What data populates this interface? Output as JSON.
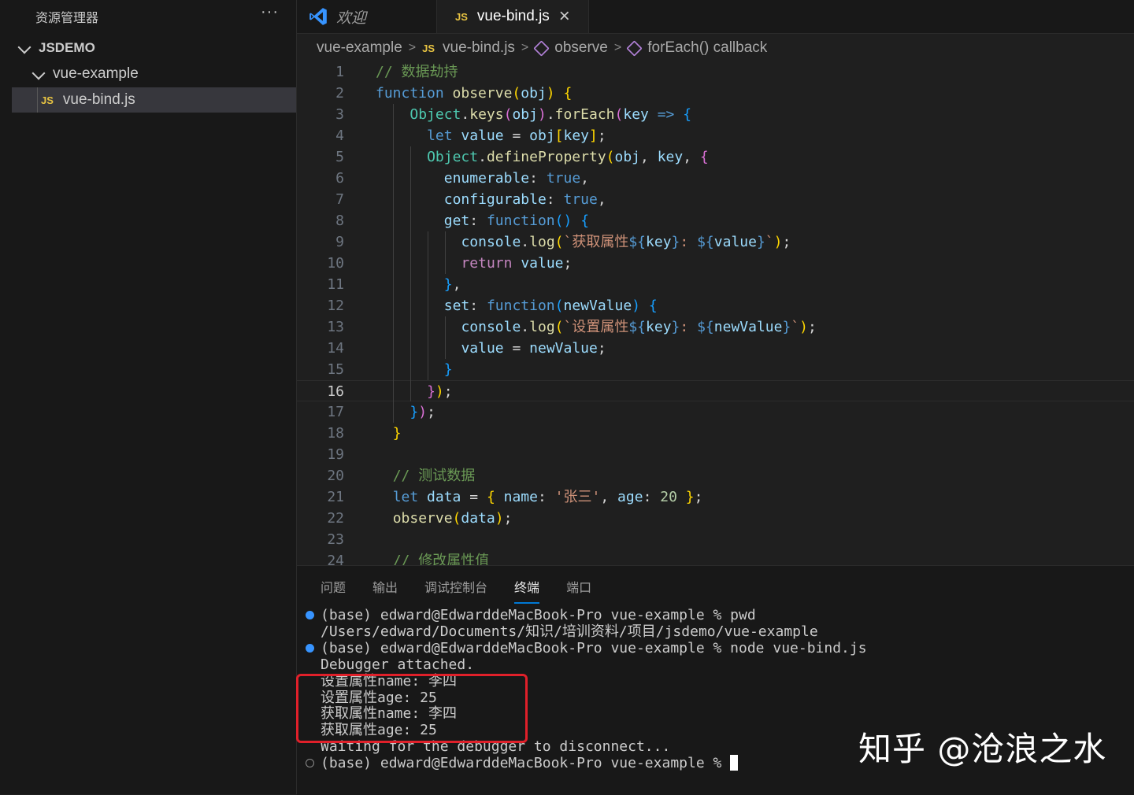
{
  "sidebar": {
    "title": "资源管理器",
    "more": "···",
    "workspace": "JSDEMO",
    "folder": "vue-example",
    "file_badge": "JS",
    "file": "vue-bind.js"
  },
  "tabs": [
    {
      "label": "欢迎",
      "active": false
    },
    {
      "label": "vue-bind.js",
      "badge": "JS",
      "active": true,
      "close": "×"
    }
  ],
  "breadcrumb": {
    "folder": "vue-example",
    "file_badge": "JS",
    "file": "vue-bind.js",
    "symbol1": "observe",
    "symbol2": "forEach() callback"
  },
  "editor": {
    "current_line": 16,
    "lines": [
      {
        "n": "1",
        "t": "// 数据劫持"
      },
      {
        "n": "2",
        "t": "function observe(obj) {"
      },
      {
        "n": "3",
        "t": "    Object.keys(obj).forEach(key => {"
      },
      {
        "n": "4",
        "t": "      let value = obj[key];"
      },
      {
        "n": "5",
        "t": "      Object.defineProperty(obj, key, {"
      },
      {
        "n": "6",
        "t": "        enumerable: true,"
      },
      {
        "n": "7",
        "t": "        configurable: true,"
      },
      {
        "n": "8",
        "t": "        get: function() {"
      },
      {
        "n": "9",
        "t": "          console.log(`获取属性${key}: ${value}`);"
      },
      {
        "n": "10",
        "t": "          return value;"
      },
      {
        "n": "11",
        "t": "        },"
      },
      {
        "n": "12",
        "t": "        set: function(newValue) {"
      },
      {
        "n": "13",
        "t": "          console.log(`设置属性${key}: ${newValue}`);"
      },
      {
        "n": "14",
        "t": "          value = newValue;"
      },
      {
        "n": "15",
        "t": "        }"
      },
      {
        "n": "16",
        "t": "      });"
      },
      {
        "n": "17",
        "t": "    });"
      },
      {
        "n": "18",
        "t": "  }"
      },
      {
        "n": "19",
        "t": ""
      },
      {
        "n": "20",
        "t": "  // 测试数据"
      },
      {
        "n": "21",
        "t": "  let data = { name: '张三', age: 20 };"
      },
      {
        "n": "22",
        "t": "  observe(data);"
      },
      {
        "n": "23",
        "t": ""
      },
      {
        "n": "24",
        "t": "  // 修改属性值"
      }
    ]
  },
  "panel": {
    "tabs": [
      "问题",
      "输出",
      "调试控制台",
      "终端",
      "端口"
    ],
    "active_tab": "终端",
    "terminal": [
      {
        "text": "(base) edward@EdwarddeMacBook-Pro vue-example % pwd",
        "dot": "filled"
      },
      {
        "text": "/Users/edward/Documents/知识/培训资料/项目/jsdemo/vue-example",
        "dot": ""
      },
      {
        "text": "(base) edward@EdwarddeMacBook-Pro vue-example % node vue-bind.js",
        "dot": "filled"
      },
      {
        "text": "Debugger attached.",
        "dot": ""
      },
      {
        "text": "设置属性name: 李四",
        "dot": ""
      },
      {
        "text": "设置属性age: 25",
        "dot": ""
      },
      {
        "text": "获取属性name: 李四",
        "dot": ""
      },
      {
        "text": "获取属性age: 25",
        "dot": ""
      },
      {
        "text": "Waiting for the debugger to disconnect...",
        "dot": ""
      },
      {
        "text": "(base) edward@EdwarddeMacBook-Pro vue-example % ",
        "dot": "hollow"
      }
    ]
  },
  "watermark": "知乎 @沧浪之水",
  "colors": {
    "accent": "#0078d4",
    "highlight_box": "#e0202a",
    "js_badge": "#e8c442",
    "vscode_logo": "#3794ff"
  }
}
